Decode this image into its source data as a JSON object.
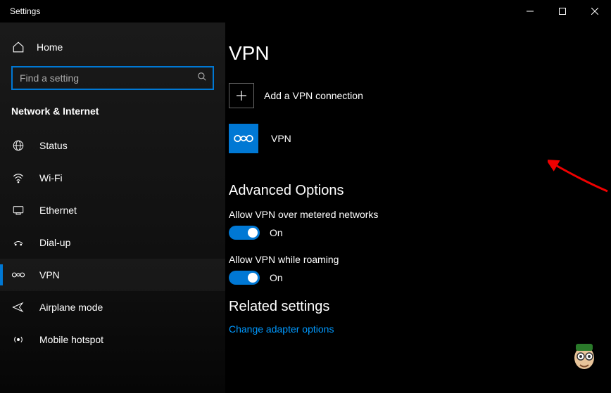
{
  "titlebar": {
    "title": "Settings"
  },
  "sidebar": {
    "home": "Home",
    "search_placeholder": "Find a setting",
    "category": "Network & Internet",
    "items": [
      {
        "label": "Status"
      },
      {
        "label": "Wi-Fi"
      },
      {
        "label": "Ethernet"
      },
      {
        "label": "Dial-up"
      },
      {
        "label": "VPN"
      },
      {
        "label": "Airplane mode"
      },
      {
        "label": "Mobile hotspot"
      }
    ]
  },
  "main": {
    "title": "VPN",
    "add_label": "Add a VPN connection",
    "entry_label": "VPN",
    "advanced_head": "Advanced Options",
    "opt1": {
      "label": "Allow VPN over metered networks",
      "state": "On"
    },
    "opt2": {
      "label": "Allow VPN while roaming",
      "state": "On"
    },
    "related_head": "Related settings",
    "link1": "Change adapter options"
  }
}
